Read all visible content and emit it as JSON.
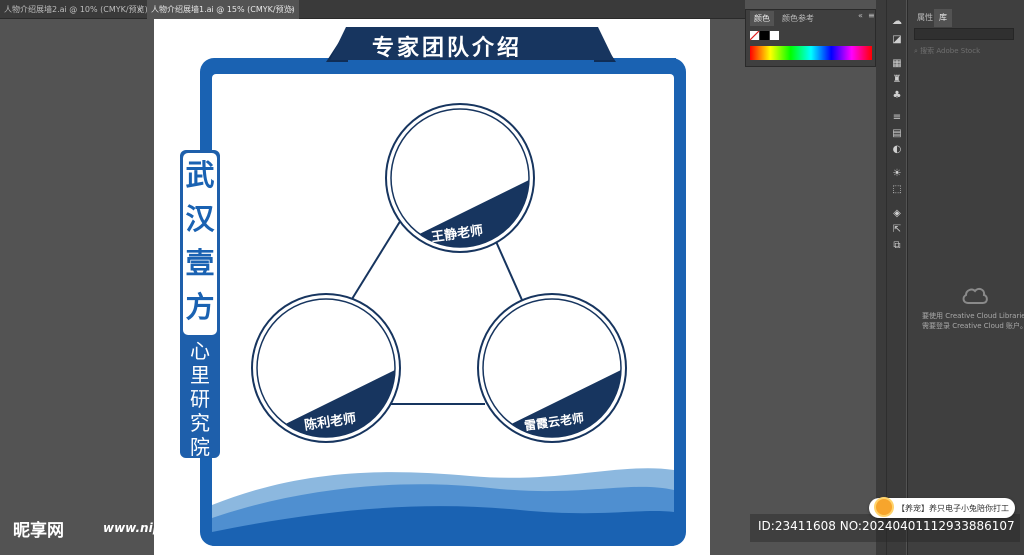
{
  "tabs": [
    {
      "label": "人物介绍展墙2.ai @ 10% (CMYK/预览)",
      "close": "×"
    },
    {
      "label": "人物介绍展墙1.ai @ 15% (CMYK/预览)",
      "close": "×"
    }
  ],
  "color_panel": {
    "tabs": [
      "颜色",
      "颜色参考"
    ],
    "collapse": "«",
    "menu": "≡"
  },
  "library_panel": {
    "tabs": [
      "属性",
      "库"
    ],
    "search_placeholder": "搜索 Adobe Stock",
    "cc_message_line1": "要使用 Creative Cloud Libraries，",
    "cc_message_line2": "需要登录 Creative Cloud 账户。"
  },
  "artwork": {
    "banner_title": "专家团队介绍",
    "vertical_title": [
      "武",
      "汉",
      "壹",
      "方"
    ],
    "vertical_subtitle": [
      "心",
      "里",
      "研",
      "究",
      "院"
    ],
    "experts": [
      "王静老师",
      "陈利老师",
      "雷霞云老师"
    ],
    "colors": {
      "primary_blue": "#1a62b2",
      "navy": "#17355f",
      "light_blue": "#8cb8df"
    }
  },
  "watermark": {
    "site_logo": "昵享网",
    "site_url": "www.nipic.cn",
    "id_text": "ID:23411608 NO:20240401112933886107",
    "toast": "【养宠】养只电子小兔陪你打工"
  }
}
